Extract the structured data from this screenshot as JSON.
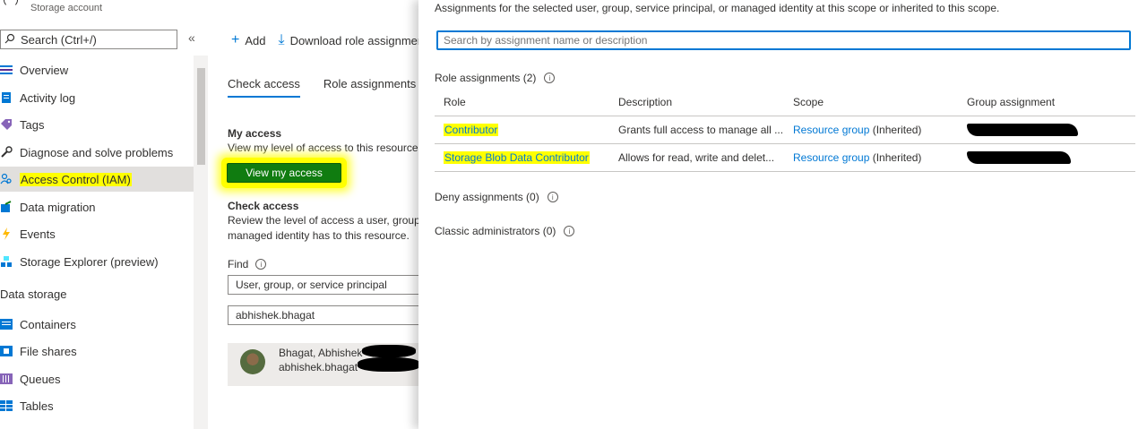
{
  "nav": {
    "subtitle": "Storage account",
    "search_placeholder": "Search (Ctrl+/)",
    "collapse": "«",
    "items": [
      {
        "label": "Overview"
      },
      {
        "label": "Activity log"
      },
      {
        "label": "Tags"
      },
      {
        "label": "Diagnose and solve problems"
      },
      {
        "label": "Access Control (IAM)"
      },
      {
        "label": "Data migration"
      },
      {
        "label": "Events"
      },
      {
        "label": "Storage Explorer (preview)"
      }
    ],
    "section": "Data storage",
    "storage_items": [
      {
        "label": "Containers"
      },
      {
        "label": "File shares"
      },
      {
        "label": "Queues"
      },
      {
        "label": "Tables"
      }
    ]
  },
  "middle": {
    "toolbar": {
      "add": "Add",
      "download": "Download role assignments"
    },
    "tabs": {
      "check": "Check access",
      "roles": "Role assignments"
    },
    "my_access": {
      "title": "My access",
      "desc": "View my level of access to this resource.",
      "button": "View my access"
    },
    "check_access": {
      "title": "Check access",
      "desc1": "Review the level of access a user, group,",
      "desc2": "managed identity has to this resource."
    },
    "find": {
      "label": "Find",
      "type_value": "User, group, or service principal",
      "query_value": "abhishek.bhagat"
    },
    "user": {
      "name": "Bhagat, Abhishek",
      "email": "abhishek.bhagat"
    }
  },
  "right": {
    "description": "Assignments for the selected user, group, service principal, or managed identity at this scope or inherited to this scope.",
    "search_placeholder": "Search by assignment name or description",
    "role_assignments_label": "Role assignments (2)",
    "columns": [
      "Role",
      "Description",
      "Scope",
      "Group assignment"
    ],
    "rows": [
      {
        "role": "Contributor",
        "description": "Grants full access to manage all ...",
        "scope_link": "Resource group",
        "scope_suffix": " (Inherited)"
      },
      {
        "role": "Storage Blob Data Contributor",
        "description": "Allows for read, write and delet...",
        "scope_link": "Resource group",
        "scope_suffix": " (Inherited)"
      }
    ],
    "deny_label": "Deny assignments (0)",
    "classic_label": "Classic administrators (0)"
  },
  "colors": {
    "accent": "#0078d4",
    "button_green": "#107c10",
    "highlight": "#ffff00"
  }
}
